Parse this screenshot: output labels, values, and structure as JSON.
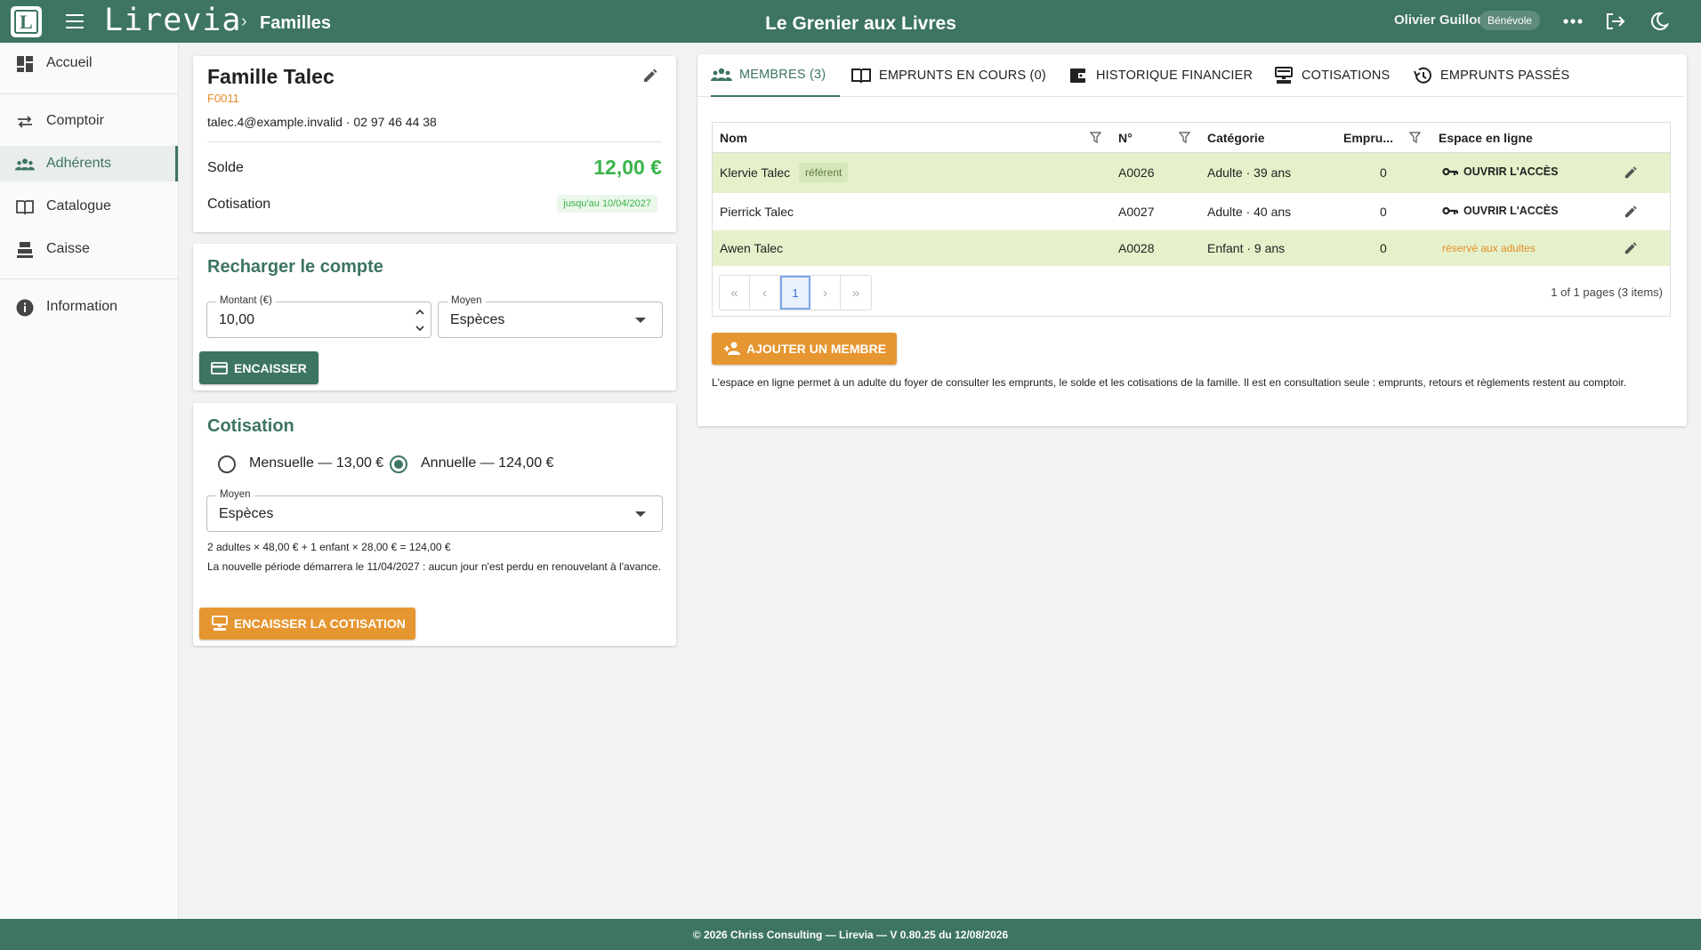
{
  "app": {
    "brand": "Lirevia",
    "breadcrumb": "Familles",
    "library_name": "Le Grenier aux Livres",
    "user": {
      "name": "Olivier Guillou",
      "role": "Bénévole"
    }
  },
  "sidebar": {
    "items": [
      {
        "label": "Accueil",
        "icon": "dashboard-icon"
      },
      {
        "label": "Comptoir",
        "icon": "swap-arrows-icon"
      },
      {
        "label": "Adhérents",
        "icon": "people-icon",
        "active": true
      },
      {
        "label": "Catalogue",
        "icon": "book-icon"
      },
      {
        "label": "Caisse",
        "icon": "cash-register-icon"
      },
      {
        "label": "Information",
        "icon": "info-icon"
      }
    ]
  },
  "family": {
    "title": "Famille Talec",
    "code": "F0011",
    "contact": "talec.4@example.invalid · 02 97 46 44 38",
    "solde_label": "Solde",
    "solde_value": "12,00 €",
    "cotisation_label": "Cotisation",
    "cotisation_badge": "jusqu'au 10/04/2027"
  },
  "recharge": {
    "title": "Recharger le compte",
    "amount_label": "Montant (€)",
    "amount_value": "10,00",
    "method_label": "Moyen",
    "method_value": "Espèces",
    "submit_label": "Encaisser"
  },
  "cotisation": {
    "title": "Cotisation",
    "options": [
      {
        "label": "Mensuelle — 13,00 €",
        "checked": false
      },
      {
        "label": "Annuelle — 124,00 €",
        "checked": true
      }
    ],
    "method_label": "Moyen",
    "method_value": "Espèces",
    "calc_line": "2 adultes × 48,00 € + 1 enfant × 28,00 € = 124,00 €",
    "period_note": "La nouvelle période démarrera le 11/04/2027 : aucun jour n'est perdu en renouvelant à l'avance.",
    "submit_label": "Encaisser la cotisation"
  },
  "tabs": [
    {
      "label": "MEMBRES (3)",
      "icon": "people-icon",
      "active": true
    },
    {
      "label": "EMPRUNTS EN COURS (0)",
      "icon": "book-open-icon"
    },
    {
      "label": "HISTORIQUE FINANCIER",
      "icon": "wallet-icon"
    },
    {
      "label": "COTISATIONS",
      "icon": "cash-register-icon"
    },
    {
      "label": "EMPRUNTS PASSÉS",
      "icon": "history-icon"
    }
  ],
  "members_table": {
    "columns": [
      "Nom",
      "N°",
      "Catégorie",
      "Empru...",
      "Espace en ligne"
    ],
    "rows": [
      {
        "name": "Klervie Talec",
        "badge": "référent",
        "number": "A0026",
        "category": "Adulte · 39 ans",
        "loans": "0",
        "access": "OUVRIR L'ACCÈS"
      },
      {
        "name": "Pierrick Talec",
        "badge": "",
        "number": "A0027",
        "category": "Adulte · 40 ans",
        "loans": "0",
        "access": "OUVRIR L'ACCÈS"
      },
      {
        "name": "Awen Talec",
        "badge": "",
        "number": "A0028",
        "category": "Enfant · 9 ans",
        "loans": "0",
        "reserved": "réservé aux adultes"
      }
    ],
    "pager": {
      "first": "«",
      "prev": "‹",
      "current": "1",
      "next": "›",
      "last": "»",
      "info": "1 of 1 pages (3 items)"
    }
  },
  "add_member_label": "Ajouter un membre",
  "online_note": "L'espace en ligne permet à un adulte du foyer de consulter les emprunts, le solde et les cotisations de la famille. Il est en consultation seule : emprunts, retours et règlements restent au comptoir.",
  "footer": "© 2026 Chriss Consulting — Lirevia — V 0.80.25 du 12/08/2026",
  "colors": {
    "primary": "#3d7464",
    "accent": "#e69630",
    "success": "#3ab54a",
    "row_highlight": "#e5f1ca"
  }
}
